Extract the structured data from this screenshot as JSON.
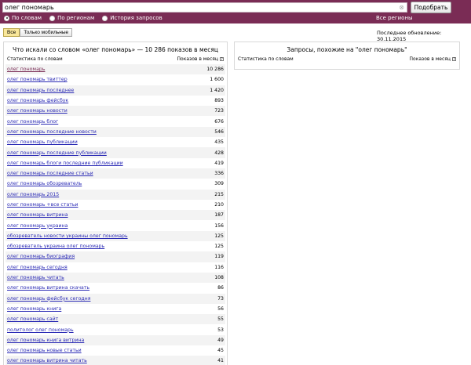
{
  "search": {
    "value": "олег пономарь",
    "clear_glyph": "⊗",
    "submit_label": "Подобрать"
  },
  "modes": [
    {
      "label": "По словам",
      "selected": true
    },
    {
      "label": "По регионам",
      "selected": false
    },
    {
      "label": "История запросов",
      "selected": false
    }
  ],
  "all_regions_label": "Все регионы",
  "filters": {
    "all_label": "Все",
    "mobile_label": "Только мобильные"
  },
  "last_update": "Последнее обновление: 30.11.2015",
  "left_panel": {
    "title": "Что искали со словом «олег пономарь» — 10 286 показов в месяц",
    "col_words": "Статистика по словам",
    "col_shows": "Показов в месяц",
    "rows": [
      {
        "query": "олег пономарь",
        "count": "10 286"
      },
      {
        "query": "олег пономарь твиттер",
        "count": "1 600"
      },
      {
        "query": "олег пономарь последнее",
        "count": "1 420"
      },
      {
        "query": "олег пономарь фейсбук",
        "count": "893"
      },
      {
        "query": "олег пономарь новости",
        "count": "723"
      },
      {
        "query": "олег пономарь блог",
        "count": "676"
      },
      {
        "query": "олег пономарь последние новости",
        "count": "546"
      },
      {
        "query": "олег пономарь публикации",
        "count": "435"
      },
      {
        "query": "олег пономарь последние публикации",
        "count": "428"
      },
      {
        "query": "олег пономарь блоги последние публикации",
        "count": "419"
      },
      {
        "query": "олег пономарь последние статьи",
        "count": "336"
      },
      {
        "query": "олег пономарь обозреватель",
        "count": "309"
      },
      {
        "query": "олег пономарь 2015",
        "count": "215"
      },
      {
        "query": "олег пономарь +все статьи",
        "count": "210"
      },
      {
        "query": "олег пономарь витрина",
        "count": "187"
      },
      {
        "query": "олег пономарь украина",
        "count": "156"
      },
      {
        "query": "обозреватель новости украины олег пономарь",
        "count": "125"
      },
      {
        "query": "обозреватель украина олег пономарь",
        "count": "125"
      },
      {
        "query": "олег пономарь биография",
        "count": "119"
      },
      {
        "query": "олег пономарь сегодня",
        "count": "116"
      },
      {
        "query": "олег пономарь читать",
        "count": "108"
      },
      {
        "query": "олег пономарь витрина скачать",
        "count": "86"
      },
      {
        "query": "олег пономарь фейсбук сегодня",
        "count": "73"
      },
      {
        "query": "олег пономарь книга",
        "count": "56"
      },
      {
        "query": "олег пономарь сайт",
        "count": "55"
      },
      {
        "query": "политолог олег пономарь",
        "count": "53"
      },
      {
        "query": "олег пономарь книга витрина",
        "count": "49"
      },
      {
        "query": "олег пономарь новые статьи",
        "count": "45"
      },
      {
        "query": "олег пономарь витрина читать",
        "count": "41"
      }
    ]
  },
  "right_panel": {
    "title": "Запросы, похожие на \"олег пономарь\"",
    "col_words": "Статистика по словам",
    "col_shows": "Показов в месяц"
  },
  "icons": {
    "info": "?"
  }
}
